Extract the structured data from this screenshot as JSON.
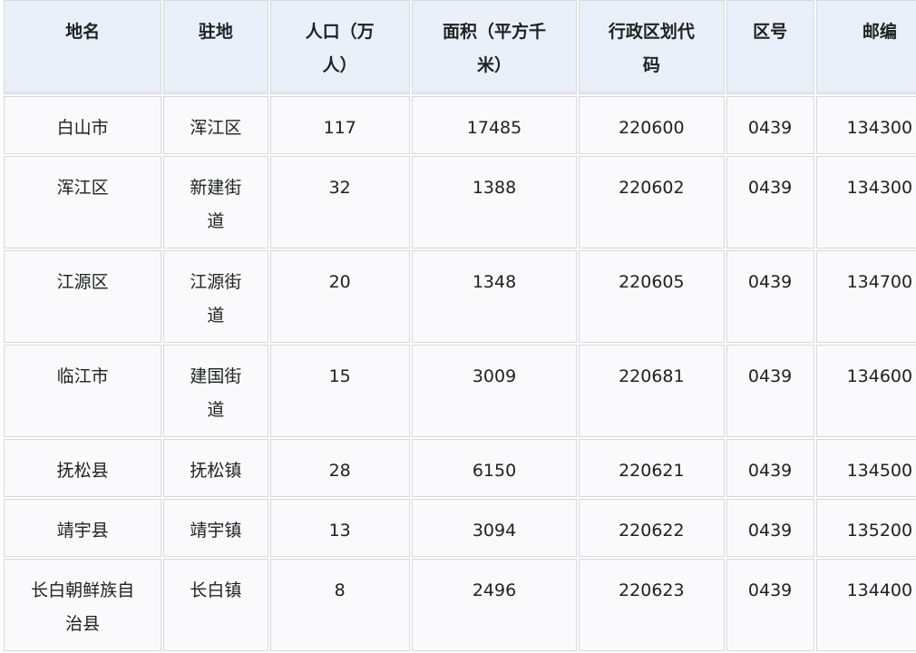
{
  "table": {
    "headers": [
      "地名",
      "驻地",
      "人口（万人）",
      "面积（平方千米）",
      "行政区划代码",
      "区号",
      "邮编"
    ],
    "rows": [
      [
        "白山市",
        "浑江区",
        "117",
        "17485",
        "220600",
        "0439",
        "134300"
      ],
      [
        "浑江区",
        "新建街道",
        "32",
        "1388",
        "220602",
        "0439",
        "134300"
      ],
      [
        "江源区",
        "江源街道",
        "20",
        "1348",
        "220605",
        "0439",
        "134700"
      ],
      [
        "临江市",
        "建国街道",
        "15",
        "3009",
        "220681",
        "0439",
        "134600"
      ],
      [
        "抚松县",
        "抚松镇",
        "28",
        "6150",
        "220621",
        "0439",
        "134500"
      ],
      [
        "靖宇县",
        "靖宇镇",
        "13",
        "3094",
        "220622",
        "0439",
        "135200"
      ],
      [
        "长白朝鲜族自治县",
        "长白镇",
        "8",
        "2496",
        "220623",
        "0439",
        "134400"
      ]
    ]
  }
}
